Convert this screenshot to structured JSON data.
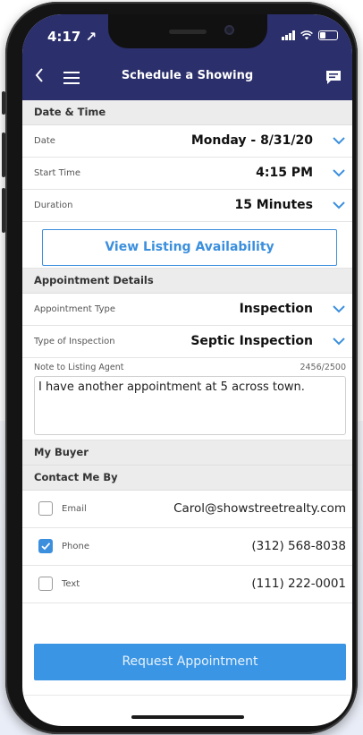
{
  "status_bar": {
    "time": "4:17 ↗"
  },
  "nav": {
    "title": "Schedule a Showing",
    "back_icon": "chevron-left-icon",
    "menu_icon": "hamburger-icon",
    "chat_icon": "chat-icon"
  },
  "date_time": {
    "header": "Date & Time",
    "date": {
      "label": "Date",
      "value": "Monday - 8/31/20"
    },
    "start_time": {
      "label": "Start Time",
      "value": "4:15 PM"
    },
    "duration": {
      "label": "Duration",
      "value": "15 Minutes"
    },
    "availability_button": "View Listing Availability"
  },
  "appointment": {
    "header": "Appointment Details",
    "type": {
      "label": "Appointment Type",
      "value": "Inspection"
    },
    "inspection_type": {
      "label": "Type of Inspection",
      "value": "Septic Inspection"
    },
    "note": {
      "label": "Note to Listing Agent",
      "count": "2456/2500",
      "value": "I have another appointment at 5 across town."
    }
  },
  "my_buyer": {
    "header": "My Buyer"
  },
  "contact": {
    "header": "Contact Me By",
    "options": [
      {
        "type": "Email",
        "value": "Carol@showstreetrealty.com",
        "checked": false
      },
      {
        "type": "Phone",
        "value": "(312) 568-8038",
        "checked": true
      },
      {
        "type": "Text",
        "value": "(111) 222-0001",
        "checked": false
      }
    ]
  },
  "request_button": "Request Appointment",
  "colors": {
    "nav_bg": "#2b2f6b",
    "accent": "#3b8fdd",
    "button_bg": "#3a95e4"
  }
}
